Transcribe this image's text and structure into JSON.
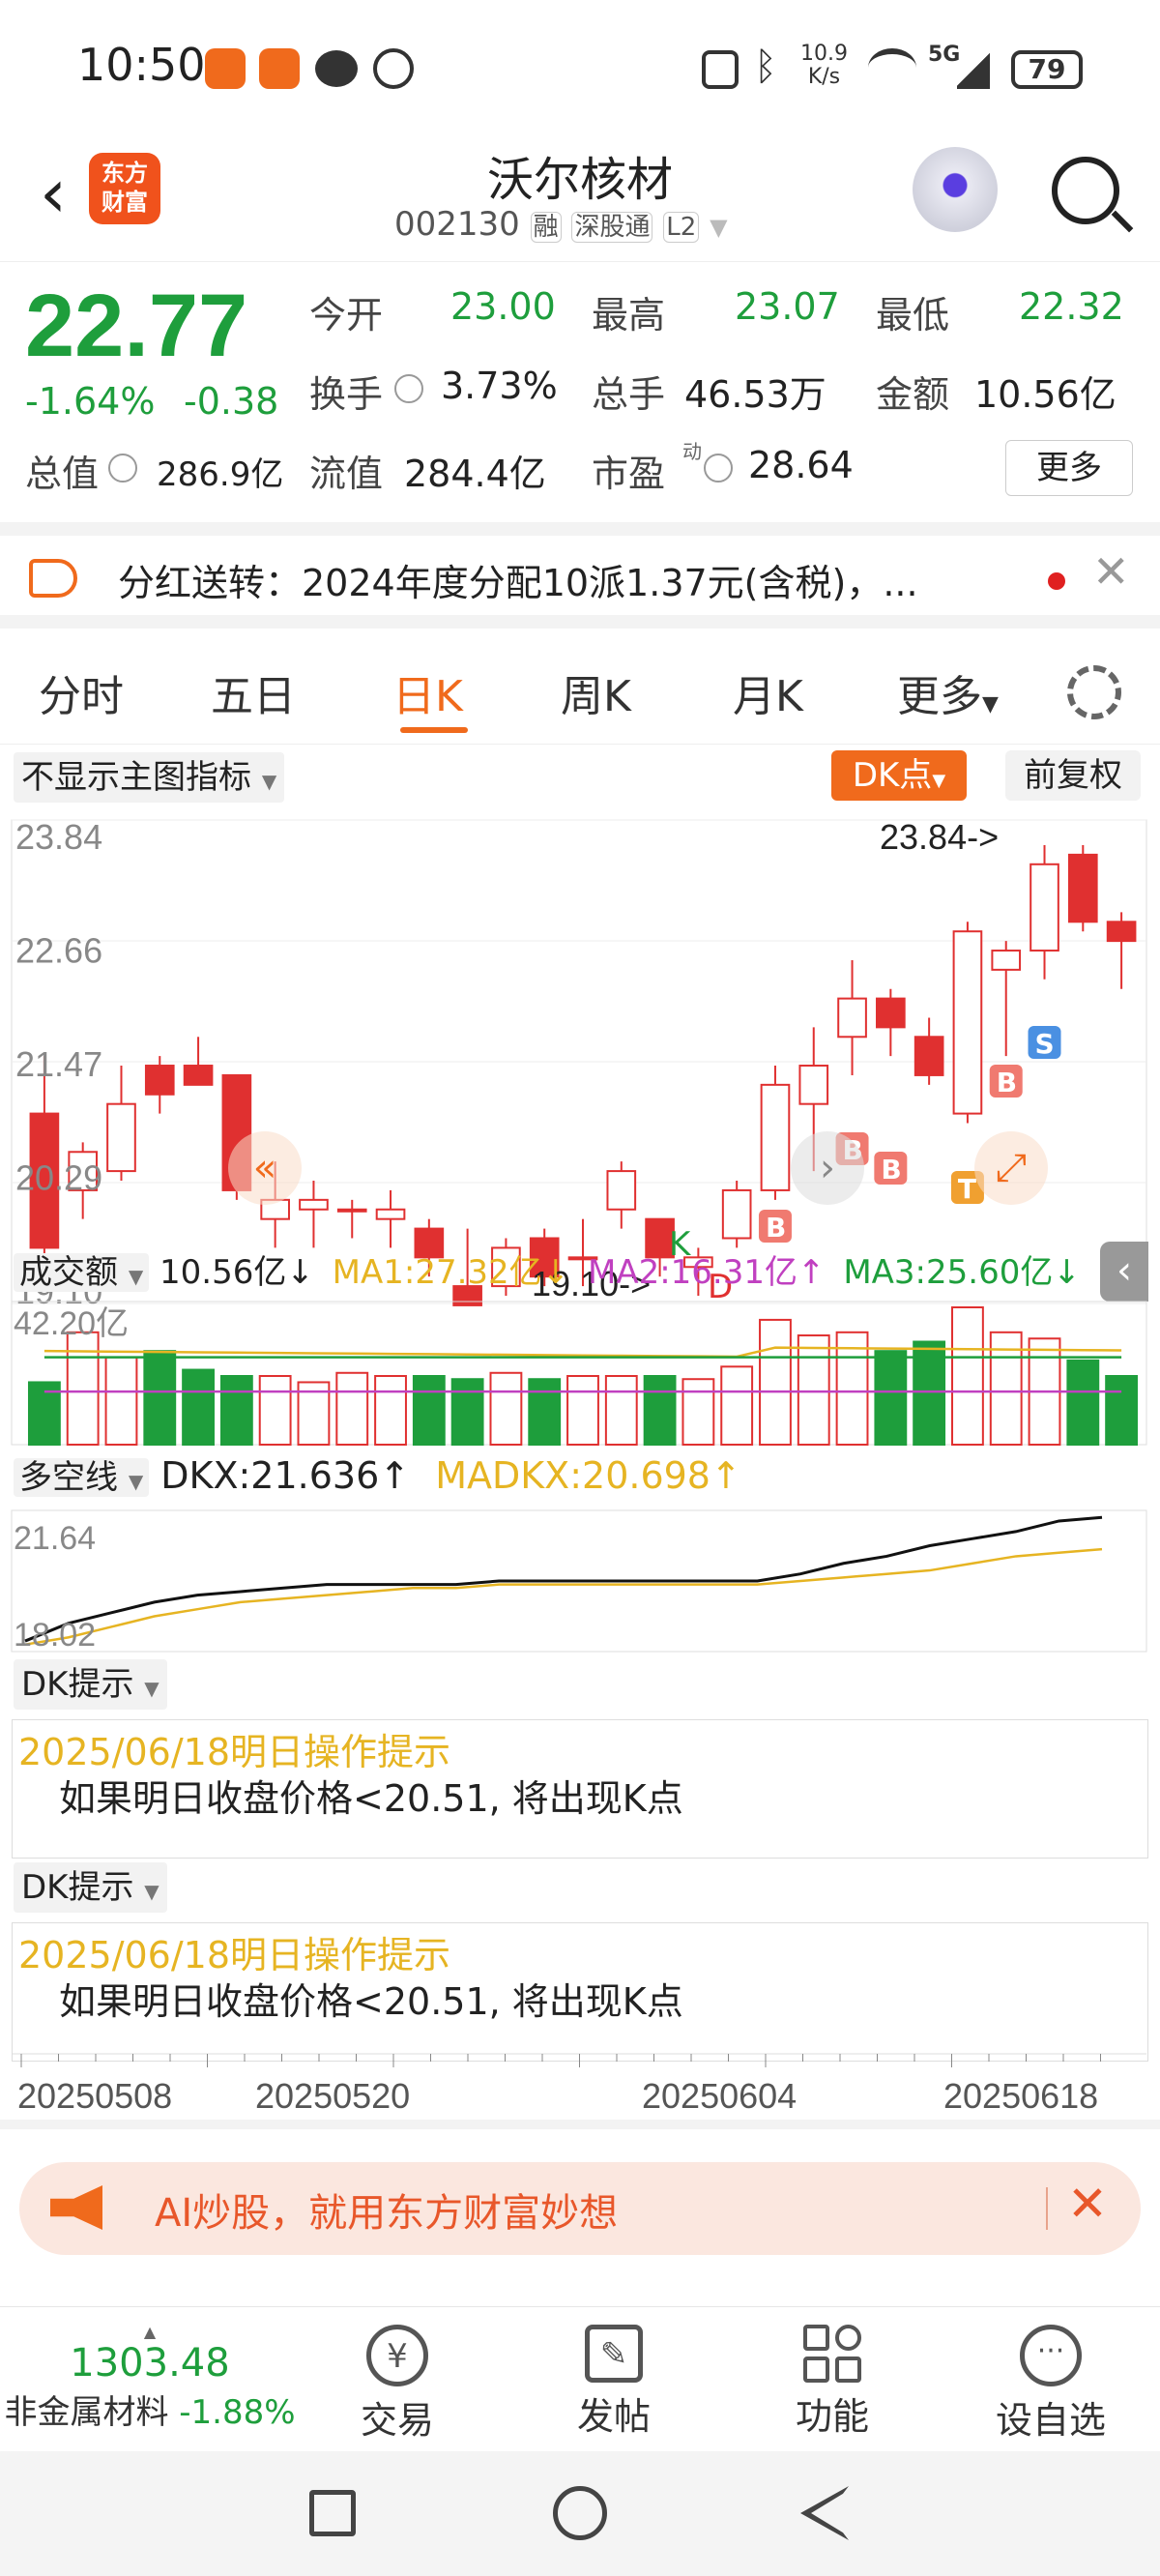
{
  "status": {
    "time": "10:50",
    "net_speed_top": "10.9",
    "net_speed_unit": "K/s",
    "network": "5G",
    "battery": "79"
  },
  "header": {
    "back_icon": "chevron-left-icon",
    "logo_line1": "东方",
    "logo_line2": "财富",
    "title": "沃尔核材",
    "code": "002130",
    "tag1": "融",
    "tag2": "深股通",
    "tag3": "L2"
  },
  "quote": {
    "price": "22.77",
    "change_pct": "-1.64%",
    "change_abs": "-0.38",
    "open_label": "今开",
    "open": "23.00",
    "high_label": "最高",
    "high": "23.07",
    "low_label": "最低",
    "low": "22.32",
    "turnover_label": "换手",
    "turnover": "3.73%",
    "volume_label": "总手",
    "volume": "46.53万",
    "amount_label": "金额",
    "amount": "10.56亿",
    "mktcap_label": "总值",
    "mktcap": "286.9亿",
    "float_label": "流值",
    "float": "284.4亿",
    "pe_label": "市盈",
    "pe_sup": "动",
    "pe": "28.64",
    "more": "更多"
  },
  "notice": {
    "text": "分红送转：2024年度分配10派1.37元(含税)，..."
  },
  "tabs": {
    "t1": "分时",
    "t2": "五日",
    "t3": "日K",
    "t4": "周K",
    "t5": "月K",
    "t6": "更多"
  },
  "chart_header": {
    "indicator_select": "不显示主图指标",
    "dk_button": "DK点",
    "adjust": "前复权"
  },
  "chart_data": [
    {
      "type": "candlestick",
      "title": "",
      "y_ticks": [
        "23.84",
        "22.66",
        "21.47",
        "20.29",
        "19.10"
      ],
      "ylim": [
        19.1,
        23.84
      ],
      "annotations": {
        "high": "23.84->",
        "low": "19.10->",
        "k_mark": "K",
        "d_mark": "D"
      },
      "x_ticks": [
        "20250508",
        "20250520",
        "20250604",
        "20250618"
      ],
      "candles": [
        {
          "o": 21.0,
          "h": 21.6,
          "l": 19.4,
          "c": 19.6
        },
        {
          "o": 20.2,
          "h": 20.7,
          "l": 19.9,
          "c": 20.6
        },
        {
          "o": 20.4,
          "h": 21.5,
          "l": 20.3,
          "c": 21.1
        },
        {
          "o": 21.5,
          "h": 21.6,
          "l": 21.0,
          "c": 21.2
        },
        {
          "o": 21.5,
          "h": 21.8,
          "l": 21.3,
          "c": 21.3
        },
        {
          "o": 21.4,
          "h": 21.4,
          "l": 20.1,
          "c": 20.2
        },
        {
          "o": 19.9,
          "h": 20.5,
          "l": 19.6,
          "c": 20.1
        },
        {
          "o": 20.0,
          "h": 20.3,
          "l": 19.6,
          "c": 20.1
        },
        {
          "o": 20.0,
          "h": 20.1,
          "l": 19.7,
          "c": 20.0
        },
        {
          "o": 19.9,
          "h": 20.2,
          "l": 19.6,
          "c": 20.0
        },
        {
          "o": 19.8,
          "h": 19.9,
          "l": 19.3,
          "c": 19.5
        },
        {
          "o": 19.2,
          "h": 19.8,
          "l": 19.0,
          "c": 19.0
        },
        {
          "o": 19.2,
          "h": 19.7,
          "l": 19.1,
          "c": 19.6
        },
        {
          "o": 19.7,
          "h": 19.8,
          "l": 19.2,
          "c": 19.3
        },
        {
          "o": 19.5,
          "h": 19.9,
          "l": 19.2,
          "c": 19.5
        },
        {
          "o": 20.0,
          "h": 20.5,
          "l": 19.8,
          "c": 20.4
        },
        {
          "o": 19.9,
          "h": 19.9,
          "l": 19.3,
          "c": 19.5
        },
        {
          "o": 19.4,
          "h": 19.6,
          "l": 19.1,
          "c": 19.5
        },
        {
          "o": 19.7,
          "h": 20.3,
          "l": 19.6,
          "c": 20.2
        },
        {
          "o": 20.2,
          "h": 21.5,
          "l": 20.1,
          "c": 21.3
        },
        {
          "o": 21.1,
          "h": 21.9,
          "l": 20.4,
          "c": 21.5
        },
        {
          "o": 21.8,
          "h": 22.6,
          "l": 21.4,
          "c": 22.2
        },
        {
          "o": 22.2,
          "h": 22.3,
          "l": 21.6,
          "c": 21.9
        },
        {
          "o": 21.8,
          "h": 22.0,
          "l": 21.3,
          "c": 21.4
        },
        {
          "o": 21.0,
          "h": 23.0,
          "l": 20.9,
          "c": 22.9
        },
        {
          "o": 22.5,
          "h": 22.8,
          "l": 21.6,
          "c": 22.7
        },
        {
          "o": 22.7,
          "h": 23.8,
          "l": 22.4,
          "c": 23.6
        },
        {
          "o": 23.7,
          "h": 23.8,
          "l": 22.9,
          "c": 23.0
        },
        {
          "o": 23.0,
          "h": 23.1,
          "l": 22.3,
          "c": 22.8
        }
      ],
      "signals": [
        "B",
        "B",
        "B",
        "T",
        "B",
        "S"
      ]
    },
    {
      "type": "bar",
      "title": "成交额",
      "legend": {
        "value": "10.56亿↓",
        "ma1": "MA1:27.32亿↓",
        "ma2": "MA2:16.31亿↑",
        "ma3": "MA3:25.60亿↓"
      },
      "y_top": "42.20亿",
      "values": [
        20,
        36,
        28,
        30,
        24,
        22,
        22,
        20,
        23,
        22,
        22,
        21,
        23,
        21,
        22,
        22,
        22,
        21,
        25,
        40,
        35,
        36,
        30,
        33,
        44,
        36,
        34,
        27,
        22
      ]
    },
    {
      "type": "line",
      "title": "多空线",
      "legend": {
        "dkx": "DKX:21.636↑",
        "madkx": "MADKX:20.698↑"
      },
      "y_ticks": [
        "21.64",
        "18.02"
      ],
      "series": [
        {
          "name": "DKX",
          "values": [
            18.1,
            18.6,
            18.9,
            19.2,
            19.4,
            19.5,
            19.6,
            19.7,
            19.7,
            19.7,
            19.7,
            19.8,
            19.8,
            19.8,
            19.8,
            19.8,
            19.8,
            19.8,
            20.0,
            20.3,
            20.5,
            20.8,
            21.0,
            21.2,
            21.5,
            21.6
          ]
        },
        {
          "name": "MADKX",
          "values": [
            18.0,
            18.2,
            18.5,
            18.8,
            19.0,
            19.2,
            19.3,
            19.4,
            19.5,
            19.6,
            19.6,
            19.7,
            19.7,
            19.7,
            19.7,
            19.7,
            19.7,
            19.7,
            19.8,
            19.9,
            20.0,
            20.1,
            20.3,
            20.5,
            20.6,
            20.7
          ]
        }
      ]
    }
  ],
  "dk_panel1": {
    "select": "DK提示",
    "date_title": "2025/06/18明日操作提示",
    "text": "如果明日收盘价格<20.51, 将出现K点"
  },
  "dk_panel2": {
    "select": "DK提示",
    "date_title": "2025/06/18明日操作提示",
    "text": "如果明日收盘价格<20.51, 将出现K点"
  },
  "ad": {
    "text": "AI炒股，就用东方财富妙想"
  },
  "bottom": {
    "index_value": "1303.48",
    "index_name": "非金属材料",
    "index_change": "-1.88%",
    "nav1": "交易",
    "nav2": "发帖",
    "nav3": "功能",
    "nav4": "设自选"
  },
  "colors": {
    "up": "#e03030",
    "down": "#1e9e3c",
    "accent": "#f06a1c",
    "ma1": "#e6b422",
    "ma2": "#c040c0",
    "ma3": "#1e9e3c"
  }
}
